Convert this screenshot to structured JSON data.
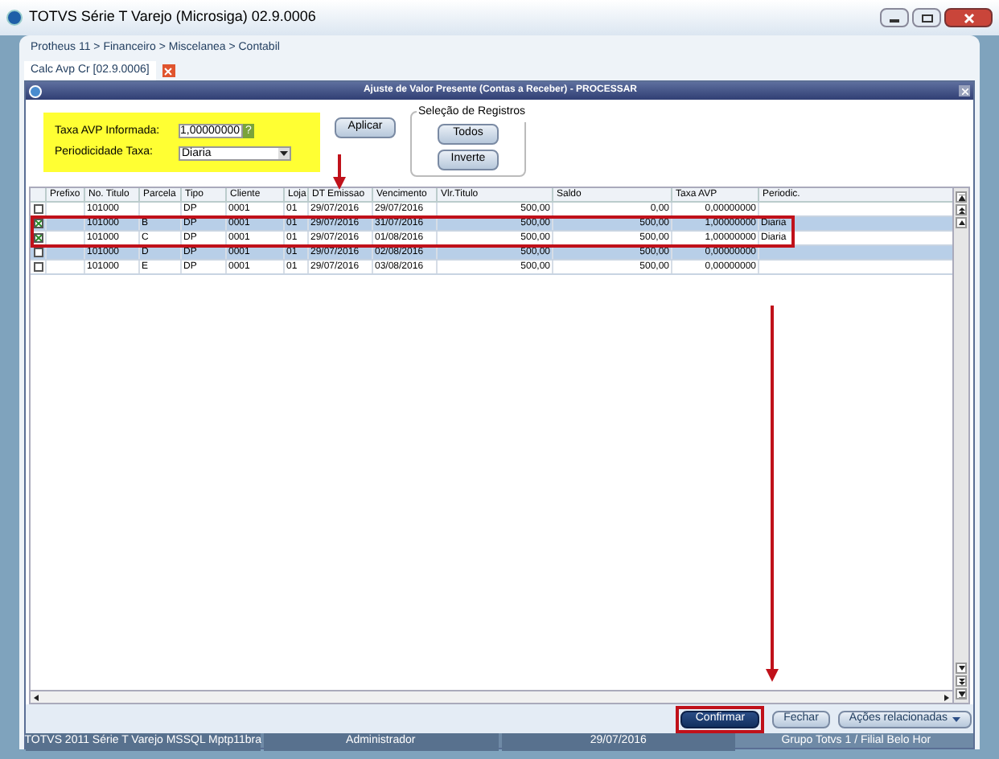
{
  "window": {
    "title": "TOTVS Série T Varejo (Microsiga) 02.9.0006"
  },
  "breadcrumb": "Protheus 11 > Financeiro > Miscelanea > Contabil",
  "tabs": [
    {
      "label": "Calc Avp Cr [02.9.0006]",
      "selected": true
    }
  ],
  "dialog": {
    "title": "Ajuste de Valor Presente (Contas a Receber) - PROCESSAR",
    "form": {
      "rate_label": "Taxa AVP Informada:",
      "rate_value": "1,00000000",
      "help_button": "?",
      "period_label": "Periodicidade Taxa:",
      "period_value": "Diaria",
      "apply_button": "Aplicar"
    },
    "selection": {
      "title": "Seleção de Registros",
      "buttons": [
        "Todos",
        "Inverte"
      ]
    },
    "table": {
      "columns": [
        "Prefixo",
        "No. Titulo",
        "Parcela",
        "Tipo",
        "Cliente",
        "Loja",
        "DT Emissao",
        "Vencimento",
        "Vlr.Titulo",
        "Saldo",
        "Taxa AVP",
        "Periodic."
      ],
      "rows": [
        {
          "checked": false,
          "cells": [
            "",
            "101000",
            "",
            "DP",
            "0001",
            "01",
            "29/07/2016",
            "29/07/2016",
            "500,00",
            "0,00",
            "0,00000000",
            ""
          ]
        },
        {
          "checked": true,
          "cells": [
            "",
            "101000",
            "B",
            "DP",
            "0001",
            "01",
            "29/07/2016",
            "31/07/2016",
            "500,00",
            "500,00",
            "1,00000000",
            "Diaria"
          ]
        },
        {
          "checked": true,
          "cells": [
            "",
            "101000",
            "C",
            "DP",
            "0001",
            "01",
            "29/07/2016",
            "01/08/2016",
            "500,00",
            "500,00",
            "1,00000000",
            "Diaria"
          ]
        },
        {
          "checked": false,
          "cells": [
            "",
            "101000",
            "D",
            "DP",
            "0001",
            "01",
            "29/07/2016",
            "02/08/2016",
            "500,00",
            "500,00",
            "0,00000000",
            ""
          ]
        },
        {
          "checked": false,
          "cells": [
            "",
            "101000",
            "E",
            "DP",
            "0001",
            "01",
            "29/07/2016",
            "03/08/2016",
            "500,00",
            "500,00",
            "0,00000000",
            ""
          ]
        }
      ]
    },
    "buttons": [
      {
        "label": "Confirmar",
        "kind": "primary"
      },
      {
        "label": "Fechar",
        "kind": "secondary"
      },
      {
        "label": "Ações relacionadas",
        "kind": "menu"
      }
    ]
  },
  "status_bar": [
    "TOTVS 2011 Série T Varejo MSSQL Mptp11bra",
    "Administrador",
    "29/07/2016",
    "Grupo Totvs 1 / Filial Belo Hor"
  ]
}
